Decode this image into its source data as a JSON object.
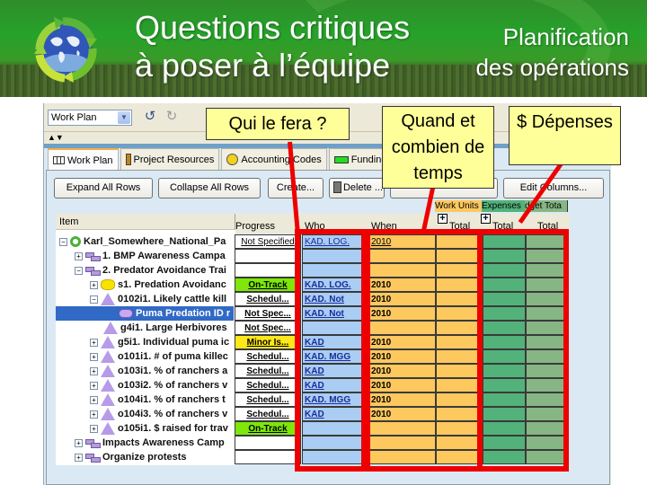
{
  "banner": {
    "title_line1": "Questions critiques",
    "title_line2": "à poser à l’équipe",
    "side_line1": "Planification",
    "side_line2": "des opérations",
    "logo": "recycle-globe-icon"
  },
  "toolbar": {
    "view_select": "Work Plan",
    "undo_icon": "undo-icon",
    "redo_icon": "redo-icon",
    "split_arrows": "▲▼"
  },
  "tabs": [
    {
      "label": "Work Plan",
      "icon": "grid-icon",
      "active": true
    },
    {
      "label": "Project Resources",
      "icon": "resource-icon",
      "active": false
    },
    {
      "label": "Accounting Codes",
      "icon": "yellow-circle-icon",
      "active": false
    },
    {
      "label": "Funding",
      "icon": "green-rect-icon",
      "active": false
    }
  ],
  "buttons": {
    "expand": "Expand All Rows",
    "collapse": "Collapse All Rows",
    "create": "Create...",
    "delete": "Delete ...",
    "edit_columns": "Edit Columns..."
  },
  "grid": {
    "headers": {
      "item": "Item",
      "progress": "Progress",
      "who": "Who",
      "when": "When",
      "work_units_group": "Work Units",
      "expenses_group": "Expenses",
      "budget_group": "dget Tota",
      "total1": "Total",
      "total2": "Total",
      "total3": "Total"
    },
    "rows": [
      {
        "item": "Karl_Somewhere_National_Pa",
        "icon": "ring",
        "level": 0,
        "expander": "−",
        "progress": "Not Specified",
        "progress_color": "#ffffff",
        "who": "KAD. LOG.",
        "when": "2010",
        "selected": false
      },
      {
        "item": "1. BMP Awareness Campa",
        "icon": "task",
        "level": 1,
        "expander": "+",
        "progress": "",
        "progress_color": "#ffffff",
        "who": "",
        "when": "",
        "selected": false
      },
      {
        "item": "2. Predator Avoidance Trai",
        "icon": "task",
        "level": 1,
        "expander": "−",
        "progress": "",
        "progress_color": "#ffffff",
        "who": "",
        "when": "",
        "selected": false
      },
      {
        "item": "s1. Predation Avoidanc",
        "icon": "hex",
        "level": 2,
        "expander": "+",
        "progress": "On-Track",
        "progress_color": "#7ee80a",
        "who": "KAD. LOG.",
        "when": "2010",
        "selected": false
      },
      {
        "item": "0102i1. Likely cattle kill",
        "icon": "tri",
        "level": 2,
        "expander": "−",
        "progress": "Schedul...",
        "progress_color": "#ffffff",
        "who": "KAD. Not",
        "when": "2010",
        "selected": false
      },
      {
        "item": "Puma Predation ID r",
        "icon": "oval",
        "level": 3,
        "expander": "",
        "progress": "Not Spec...",
        "progress_color": "#ffffff",
        "who": "KAD. Not",
        "when": "2010",
        "selected": true
      },
      {
        "item": "g4i1. Large Herbivores",
        "icon": "tri",
        "level": 2,
        "expander": "",
        "progress": "Not Spec...",
        "progress_color": "#ffffff",
        "who": "",
        "when": "",
        "selected": false
      },
      {
        "item": "g5i1. Individual puma ic",
        "icon": "tri",
        "level": 2,
        "expander": "+",
        "progress": "Minor Is...",
        "progress_color": "#fde81a",
        "who": "KAD",
        "when": "2010",
        "selected": false
      },
      {
        "item": "o101i1. # of puma killec",
        "icon": "tri",
        "level": 2,
        "expander": "+",
        "progress": "Schedul...",
        "progress_color": "#ffffff",
        "who": "KAD. MGG",
        "when": "2010",
        "selected": false
      },
      {
        "item": "o103i1. % of ranchers a",
        "icon": "tri",
        "level": 2,
        "expander": "+",
        "progress": "Schedul...",
        "progress_color": "#ffffff",
        "who": "KAD",
        "when": "2010",
        "selected": false
      },
      {
        "item": "o103i2. % of ranchers v",
        "icon": "tri",
        "level": 2,
        "expander": "+",
        "progress": "Schedul...",
        "progress_color": "#ffffff",
        "who": "KAD",
        "when": "2010",
        "selected": false
      },
      {
        "item": "o104i1. % of ranchers t",
        "icon": "tri",
        "level": 2,
        "expander": "+",
        "progress": "Schedul...",
        "progress_color": "#ffffff",
        "who": "KAD. MGG",
        "when": "2010",
        "selected": false
      },
      {
        "item": "o104i3. % of ranchers v",
        "icon": "tri",
        "level": 2,
        "expander": "+",
        "progress": "Schedul...",
        "progress_color": "#ffffff",
        "who": "KAD",
        "when": "2010",
        "selected": false
      },
      {
        "item": "o105i1. $ raised for trav",
        "icon": "tri",
        "level": 2,
        "expander": "+",
        "progress": "On-Track",
        "progress_color": "#7ee80a",
        "who": "",
        "when": "",
        "selected": false
      },
      {
        "item": "Impacts Awareness Camp",
        "icon": "task",
        "level": 1,
        "expander": "+",
        "progress": "",
        "progress_color": "#ffffff",
        "who": "",
        "when": "",
        "selected": false
      },
      {
        "item": "Organize protests",
        "icon": "task",
        "level": 1,
        "expander": "+",
        "progress": "",
        "progress_color": "#ffffff",
        "who": "",
        "when": "",
        "selected": false
      }
    ]
  },
  "callouts": {
    "who": "Qui le fera ?",
    "when": "Quand et combien de temps",
    "expenses": "$ Dépenses"
  },
  "colors": {
    "banner_green": "#26a22a",
    "callout_yellow": "#ffff99",
    "highlight_red": "#ee0000",
    "who_blue": "#a9cdf3",
    "when_orange": "#fdc85e",
    "expenses_green": "#52b27a",
    "budget_green": "#86b683",
    "selected_row": "#3169c6"
  }
}
